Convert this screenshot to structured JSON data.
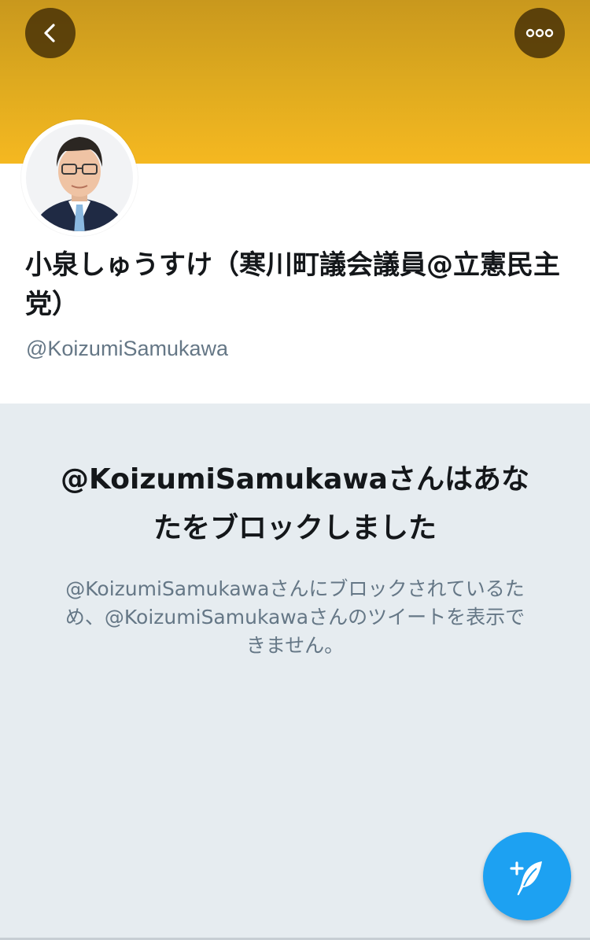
{
  "header": {
    "back_icon": "chevron-left-icon",
    "more_icon": "more-horizontal-icon",
    "banner_color": "#f5b820"
  },
  "profile": {
    "display_name": "小泉しゅうすけ（寒川町議会議員@立憲民主党）",
    "handle": "@KoizumiSamukawa",
    "avatar_icon": "profile-photo"
  },
  "blocked": {
    "title": "@KoizumiSamukawaさんはあなたをブロックしました",
    "body": "@KoizumiSamukawaさんにブロックされているため、@KoizumiSamukawaさんのツイートを表示できません。"
  },
  "compose": {
    "icon": "compose-tweet-icon",
    "color": "#1da1f2"
  }
}
